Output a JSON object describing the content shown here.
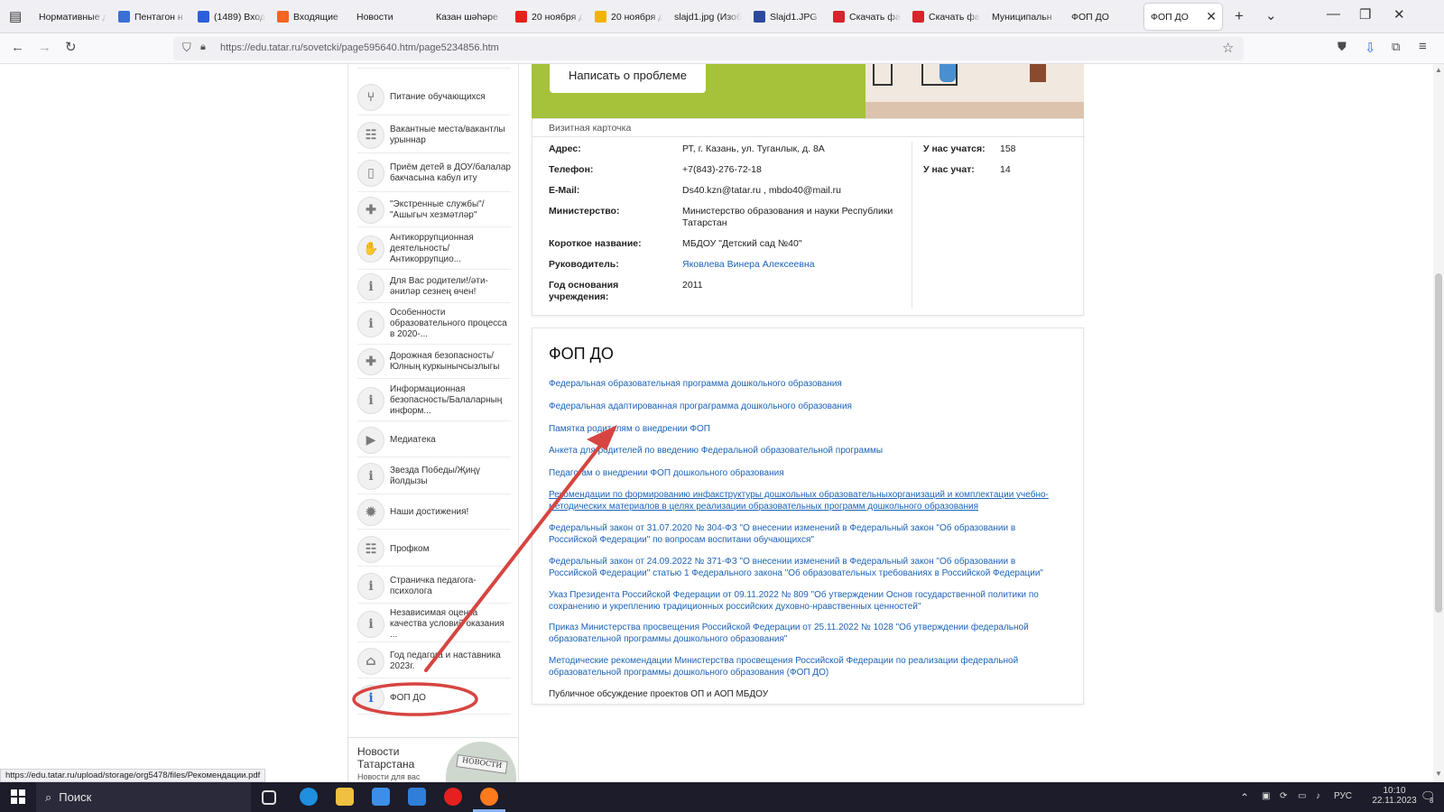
{
  "browser": {
    "tabs": [
      {
        "title": "Нормативные д",
        "color": ""
      },
      {
        "title": "Пентагон н",
        "color": "#3b6fd6"
      },
      {
        "title": "(1489) Входя",
        "color": "#2b5fd9"
      },
      {
        "title": "Входящие",
        "color": "#f26522"
      },
      {
        "title": "Новости",
        "color": ""
      },
      {
        "title": "Казан шәһәре",
        "color": ""
      },
      {
        "title": "20 ноября д",
        "color": "#e4221b"
      },
      {
        "title": "20 ноября д",
        "color": "#f2b400"
      },
      {
        "title": "slajd1.jpg (Изоб",
        "color": ""
      },
      {
        "title": "Slajd1.JPG (",
        "color": "#2b4a9e"
      },
      {
        "title": "Скачать фа",
        "color": "#d8232a"
      },
      {
        "title": "Скачать фа",
        "color": "#d8232a"
      },
      {
        "title": "Муниципальн",
        "color": ""
      },
      {
        "title": "ФОП ДО",
        "color": ""
      },
      {
        "title": "ФОП ДО",
        "color": "",
        "active": true
      }
    ],
    "new_tab_icon": "plus-icon",
    "url": "https://edu.tatar.ru/sovetcki/page595640.htm/page5234856.htm",
    "status_url": "https://edu.tatar.ru/upload/storage/org5478/files/Рекомендации.pdf"
  },
  "sidebar": {
    "items": [
      {
        "label": "Питание обучающихся",
        "icon": "cutlery-icon"
      },
      {
        "label": "Вакантные места/вакантлы урыннар",
        "icon": "people-icon"
      },
      {
        "label": "Приём детей в ДОУ/балалар бакчасына кабул иту",
        "icon": "door-icon"
      },
      {
        "label": "\"Экстренные службы\"/ \"Ашыгыч хезмәтләр\"",
        "icon": "cross-icon"
      },
      {
        "label": "Антикоррупционная деятельность/ Антикоррупцио...",
        "icon": "hand-icon"
      },
      {
        "label": "Для Вас родители!/әти-әниләр сезнең өчен!",
        "icon": "info-icon"
      },
      {
        "label": "Особенности образовательного процесса в 2020-...",
        "icon": "info-icon"
      },
      {
        "label": "Дорожная безопасность/Юлның куркынычсызлыгы",
        "icon": "cross-icon"
      },
      {
        "label": "Информационная безопасность/Балаларның информ...",
        "icon": "info-icon"
      },
      {
        "label": "Медиатека",
        "icon": "play-icon"
      },
      {
        "label": "Звезда Победы/Җиңү йолдызы",
        "icon": "info-icon"
      },
      {
        "label": "Наши достижения!",
        "icon": "medal-icon"
      },
      {
        "label": "Профком",
        "icon": "people-icon"
      },
      {
        "label": "Страничка педагога-психолога",
        "icon": "info-icon"
      },
      {
        "label": "Независимая оценка качества условий оказания ...",
        "icon": "info-icon"
      },
      {
        "label": "Год педагога и наставника 2023г.",
        "icon": "graduation-cap-icon"
      },
      {
        "label": "ФОП ДО",
        "icon": "info-icon"
      }
    ],
    "news": {
      "title": "Новости Татарстана",
      "subtitle": "Новости для вас",
      "logo_text": "НОВОСТИ"
    }
  },
  "banner": {
    "button_label": "Написать о проблеме"
  },
  "card": {
    "title": "Визитная карточка",
    "address_label": "Адрес:",
    "address": "РТ, г. Казань, ул. Туганлык, д. 8А",
    "phone_label": "Телефон:",
    "phone": "+7(843)-276-72-18",
    "email_label": "E-Mail:",
    "email": "Ds40.kzn@tatar.ru , mbdo40@mail.ru",
    "ministry_label": "Министерство:",
    "ministry": "Министерство образования и науки Республики Татарстан",
    "short_label": "Короткое название:",
    "short": "МБДОУ \"Детский сад №40\"",
    "head_label": "Руководитель:",
    "head": "Яковлева Винера Алексеевна",
    "year_label": "Год основания учреждения:",
    "year": "2011",
    "students_label": "У нас учатся:",
    "students": "158",
    "teachers_label": "У нас учат:",
    "teachers": "14"
  },
  "fop": {
    "title": "ФОП ДО",
    "links": [
      "Федеральная образовательная программа дошкольного образования",
      "Федеральная адаптированная програграмма дошкольного образования",
      "Памятка родителям о внедрении ФОП",
      "Анкета для родителей по введению Федеральной образовательной программы",
      "Педагогам о внедрении ФОП дошкольного образования",
      "Рекомендации по формированию инфакструктуры дошкольных образовательныхорганизаций и комплектации учебно-методических материалов в целях реализации образовательных программ дошкольного образования",
      "Федеральный закон от 31.07.2020 № 304-ФЗ \"О внесении изменений  в Федеральный закон \"Об образовании в Российской Федерации\" по вопросам воспитани обучающихся\"",
      "Федеральный закон от 24.09.2022 № 371-ФЗ \"О внесении изменений в Федеральный  закон \"Об образовании в Российской Федерации\" статью 1 Федерального закона \"Об образовательных требованиях в Российской Федерации\"",
      "Указ Президента Российской Федерации от 09.11.2022 № 809 \"Об утверждении Основ государственной политики по сохранению и укреплению традиционных российских духовно-нравственных  ценностей\"",
      "Приказ Министерства просвещения  Российской Федерации  от 25.11.2022 № 1028 \"Об утверждении федеральной образовательной программы  дошкольного образования\"",
      "Методические рекомендации Министерства просвещения Российской Федерации по реализации федеральной образовательной программы  дошкольного  образования (ФОП ДО)",
      "Публичное обсуждение проектов ОП и АОП МБДОУ"
    ]
  },
  "taskbar": {
    "search_label": "Поиск",
    "lang": "РУС",
    "time": "10:10",
    "date": "22.11.2023",
    "notifications": "3"
  },
  "colors": {
    "accent_link": "#1c63b7",
    "annotation": "#d64541",
    "banner_green": "#a5c23a"
  }
}
